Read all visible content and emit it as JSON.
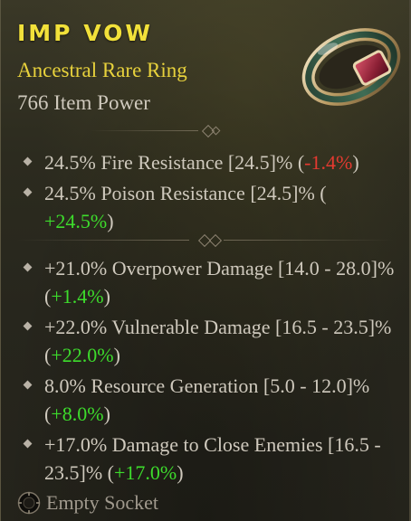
{
  "item": {
    "name": "IMP VOW",
    "type": "Ancestral Rare Ring",
    "power": "766 Item Power",
    "image_icon": "ring-icon"
  },
  "implicits": [
    {
      "text": "24.5% Fire Resistance [24.5]% (",
      "delta": "-1.4%",
      "delta_kind": "negative",
      "tail": ")"
    },
    {
      "text": "24.5% Poison Resistance [24.5]% (",
      "delta": "+24.5%",
      "delta_kind": "positive",
      "tail": ")"
    }
  ],
  "affixes": [
    {
      "text": "+21.0% Overpower Damage [14.0 - 28.0]% (",
      "delta": "+1.4%",
      "delta_kind": "positive",
      "tail": ")"
    },
    {
      "text": "+22.0% Vulnerable Damage [16.5 - 23.5]% (",
      "delta": "+22.0%",
      "delta_kind": "positive",
      "tail": ")"
    },
    {
      "text": "8.0% Resource Generation [5.0 - 12.0]% (",
      "delta": "+8.0%",
      "delta_kind": "positive",
      "tail": ")"
    },
    {
      "text": "+17.0% Damage to Close Enemies [16.5 - 23.5]% (",
      "delta": "+17.0%",
      "delta_kind": "positive",
      "tail": ")"
    }
  ],
  "socket": {
    "label": "Empty Socket",
    "icon": "socket-icon"
  },
  "colors": {
    "name": "#f2e13a",
    "rarity": "#e7d13c",
    "positive": "#3ddc2c",
    "negative": "#e53a30"
  }
}
